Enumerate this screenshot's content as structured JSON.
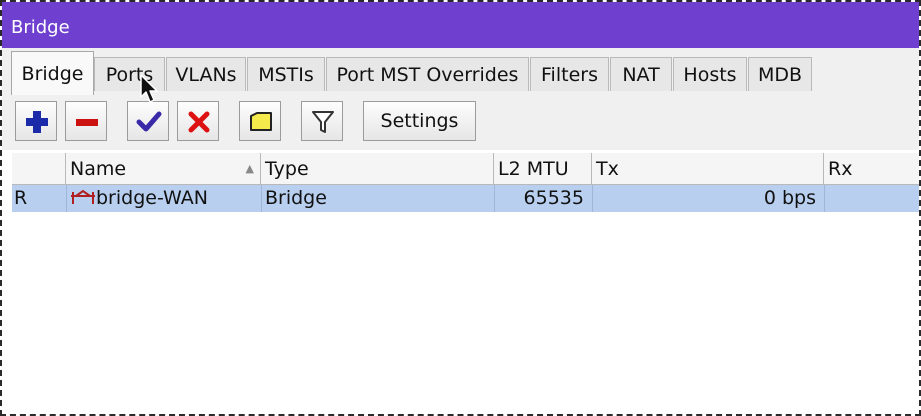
{
  "window": {
    "title": "Bridge"
  },
  "tabs": [
    {
      "label": "Bridge",
      "active": true
    },
    {
      "label": "Ports"
    },
    {
      "label": "VLANs"
    },
    {
      "label": "MSTIs"
    },
    {
      "label": "Port MST Overrides"
    },
    {
      "label": "Filters"
    },
    {
      "label": "NAT"
    },
    {
      "label": "Hosts"
    },
    {
      "label": "MDB"
    }
  ],
  "toolbar": {
    "buttons": [
      {
        "icon": "plus-icon"
      },
      {
        "icon": "minus-icon"
      },
      {
        "icon": "check-icon"
      },
      {
        "icon": "x-icon"
      },
      {
        "icon": "comment-icon"
      },
      {
        "icon": "filter-icon"
      }
    ],
    "settings_label": "Settings"
  },
  "table": {
    "columns": [
      "",
      "Name",
      "Type",
      "L2 MTU",
      "Tx",
      "Rx"
    ],
    "rows": [
      {
        "flag": "R",
        "name": "bridge-WAN",
        "type": "Bridge",
        "l2mtu": "65535",
        "tx": "0 bps",
        "rx": ""
      }
    ]
  },
  "colors": {
    "titlebar": "#6f3fd0",
    "selected_row": "#b8cff0",
    "plus": "#1a2aa8",
    "remove": "#cc1111",
    "check": "#3a2aa8"
  }
}
